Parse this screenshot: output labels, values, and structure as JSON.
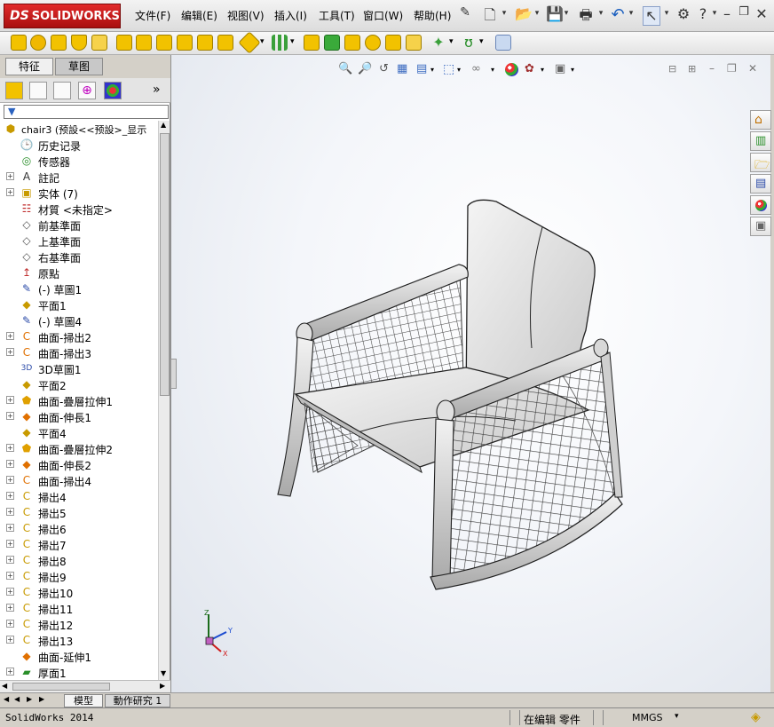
{
  "app": {
    "logo": "SOLIDWORKS",
    "logo_prefix": "DS"
  },
  "menu": [
    "文件(F)",
    "编辑(E)",
    "视图(V)",
    "插入(I)",
    "工具(T)",
    "窗口(W)",
    "帮助(H)"
  ],
  "left_tabs": {
    "feature": "特征",
    "sketch": "草图"
  },
  "tree": [
    {
      "label": "chair3  (预設<<预設>_显示",
      "icon": "part-icon",
      "plus": false
    },
    {
      "label": "历史记录",
      "icon": "history-icon",
      "plus": false
    },
    {
      "label": "传感器",
      "icon": "sensor-icon",
      "plus": false
    },
    {
      "label": "註記",
      "icon": "annotation-icon",
      "plus": true
    },
    {
      "label": "实体 (7)",
      "icon": "solid-bodies-icon",
      "plus": true
    },
    {
      "label": "材質 <未指定>",
      "icon": "material-icon",
      "plus": false
    },
    {
      "label": "前基準面",
      "icon": "plane-icon",
      "plus": false
    },
    {
      "label": "上基準面",
      "icon": "plane-icon",
      "plus": false
    },
    {
      "label": "右基準面",
      "icon": "plane-icon",
      "plus": false
    },
    {
      "label": "原點",
      "icon": "origin-icon",
      "plus": false
    },
    {
      "label": "(-) 草圖1",
      "icon": "sketch-icon",
      "plus": false
    },
    {
      "label": "平面1",
      "icon": "plane-feature-icon",
      "plus": false
    },
    {
      "label": "(-) 草圖4",
      "icon": "sketch-icon",
      "plus": false
    },
    {
      "label": "曲面-掃出2",
      "icon": "surface-sweep-icon",
      "plus": true
    },
    {
      "label": "曲面-掃出3",
      "icon": "surface-sweep-icon",
      "plus": true
    },
    {
      "label": "3D草圖1",
      "icon": "3d-sketch-icon",
      "plus": false
    },
    {
      "label": "平面2",
      "icon": "plane-feature-icon",
      "plus": false
    },
    {
      "label": "曲面-疊層拉伸1",
      "icon": "surface-loft-icon",
      "plus": true
    },
    {
      "label": "曲面-伸長1",
      "icon": "surface-extend-icon",
      "plus": true
    },
    {
      "label": "平面4",
      "icon": "plane-feature-icon",
      "plus": false
    },
    {
      "label": "曲面-疊層拉伸2",
      "icon": "surface-loft-icon",
      "plus": true
    },
    {
      "label": "曲面-伸長2",
      "icon": "surface-extend-icon",
      "plus": true
    },
    {
      "label": "曲面-掃出4",
      "icon": "surface-sweep-icon",
      "plus": true
    },
    {
      "label": "掃出4",
      "icon": "sweep-icon",
      "plus": true
    },
    {
      "label": "掃出5",
      "icon": "sweep-icon",
      "plus": true
    },
    {
      "label": "掃出6",
      "icon": "sweep-icon",
      "plus": true
    },
    {
      "label": "掃出7",
      "icon": "sweep-icon",
      "plus": true
    },
    {
      "label": "掃出8",
      "icon": "sweep-icon",
      "plus": true
    },
    {
      "label": "掃出9",
      "icon": "sweep-icon",
      "plus": true
    },
    {
      "label": "掃出10",
      "icon": "sweep-icon",
      "plus": true
    },
    {
      "label": "掃出11",
      "icon": "sweep-icon",
      "plus": true
    },
    {
      "label": "掃出12",
      "icon": "sweep-icon",
      "plus": true
    },
    {
      "label": "掃出13",
      "icon": "sweep-icon",
      "plus": true
    },
    {
      "label": "曲面-延伸1",
      "icon": "surface-extend-icon",
      "plus": false
    },
    {
      "label": "厚面1",
      "icon": "thicken-icon",
      "plus": true
    }
  ],
  "bottom_tabs": {
    "model": "模型",
    "motion": "動作研究 1"
  },
  "status": {
    "app_version": "SolidWorks 2014",
    "edit_mode": "在编辑 零件",
    "units": "MMGS"
  },
  "triad": {
    "x": "X",
    "y": "Y",
    "z": "Z"
  },
  "colors": {
    "brand_red": "#c41a1a",
    "accent_yellow": "#f2c200",
    "viewport_bg": "#f4f6fa"
  }
}
